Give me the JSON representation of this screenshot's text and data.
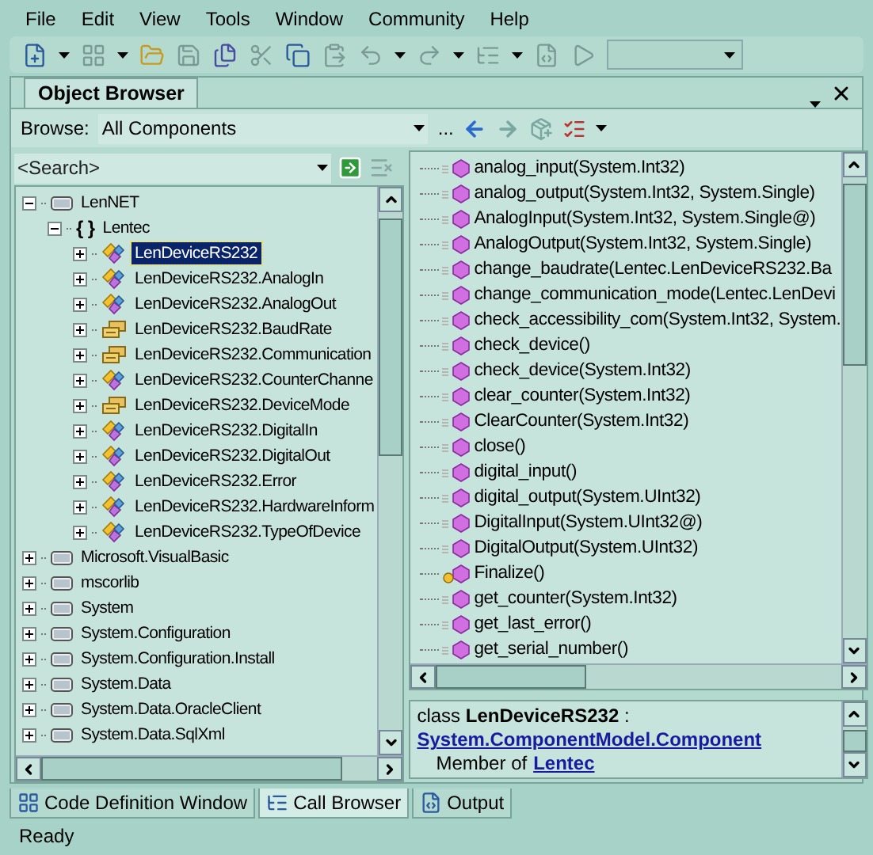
{
  "menu": [
    "File",
    "Edit",
    "View",
    "Tools",
    "Window",
    "Community",
    "Help"
  ],
  "doc_tab": {
    "title": "Object Browser"
  },
  "browse": {
    "label": "Browse:",
    "value": "All Components",
    "more": "..."
  },
  "search": {
    "placeholder": "<Search>"
  },
  "tree": [
    {
      "label": "LenNET",
      "kind": "assembly",
      "expanded": true,
      "selected": false,
      "children": [
        {
          "label": "Lentec",
          "kind": "namespace",
          "icon": "{ }",
          "expanded": true,
          "selected": false,
          "children": [
            {
              "label": "LenDeviceRS232",
              "kind": "class",
              "expanded": false,
              "selected": true
            },
            {
              "label": "LenDeviceRS232.AnalogIn",
              "kind": "class",
              "expanded": false,
              "selected": false
            },
            {
              "label": "LenDeviceRS232.AnalogOut",
              "kind": "class",
              "expanded": false,
              "selected": false
            },
            {
              "label": "LenDeviceRS232.BaudRate",
              "kind": "enum",
              "expanded": false,
              "selected": false
            },
            {
              "label": "LenDeviceRS232.Communication",
              "kind": "enum",
              "expanded": false,
              "selected": false
            },
            {
              "label": "LenDeviceRS232.CounterChanne",
              "kind": "class",
              "expanded": false,
              "selected": false
            },
            {
              "label": "LenDeviceRS232.DeviceMode",
              "kind": "enum",
              "expanded": false,
              "selected": false
            },
            {
              "label": "LenDeviceRS232.DigitalIn",
              "kind": "class",
              "expanded": false,
              "selected": false
            },
            {
              "label": "LenDeviceRS232.DigitalOut",
              "kind": "class",
              "expanded": false,
              "selected": false
            },
            {
              "label": "LenDeviceRS232.Error",
              "kind": "class",
              "expanded": false,
              "selected": false
            },
            {
              "label": "LenDeviceRS232.HardwareInform",
              "kind": "class",
              "expanded": false,
              "selected": false
            },
            {
              "label": "LenDeviceRS232.TypeOfDevice",
              "kind": "class",
              "expanded": false,
              "selected": false
            }
          ]
        }
      ]
    },
    {
      "label": "Microsoft.VisualBasic",
      "kind": "assembly",
      "expanded": false,
      "selected": false
    },
    {
      "label": "mscorlib",
      "kind": "assembly",
      "expanded": false,
      "selected": false
    },
    {
      "label": "System",
      "kind": "assembly",
      "expanded": false,
      "selected": false
    },
    {
      "label": "System.Configuration",
      "kind": "assembly",
      "expanded": false,
      "selected": false
    },
    {
      "label": "System.Configuration.Install",
      "kind": "assembly",
      "expanded": false,
      "selected": false
    },
    {
      "label": "System.Data",
      "kind": "assembly",
      "expanded": false,
      "selected": false
    },
    {
      "label": "System.Data.OracleClient",
      "kind": "assembly",
      "expanded": false,
      "selected": false
    },
    {
      "label": "System.Data.SqlXml",
      "kind": "assembly",
      "expanded": false,
      "selected": false
    }
  ],
  "members": [
    {
      "label": "analog_input(System.Int32)",
      "kind": "public"
    },
    {
      "label": "analog_output(System.Int32, System.Single)",
      "kind": "public"
    },
    {
      "label": "AnalogInput(System.Int32, System.Single@)",
      "kind": "public"
    },
    {
      "label": "AnalogOutput(System.Int32, System.Single)",
      "kind": "public"
    },
    {
      "label": "change_baudrate(Lentec.LenDeviceRS232.Ba",
      "kind": "public"
    },
    {
      "label": "change_communication_mode(Lentec.LenDevi",
      "kind": "public"
    },
    {
      "label": "check_accessibility_com(System.Int32, System.",
      "kind": "public"
    },
    {
      "label": "check_device()",
      "kind": "public"
    },
    {
      "label": "check_device(System.Int32)",
      "kind": "public"
    },
    {
      "label": "clear_counter(System.Int32)",
      "kind": "public"
    },
    {
      "label": "ClearCounter(System.Int32)",
      "kind": "public"
    },
    {
      "label": "close()",
      "kind": "public"
    },
    {
      "label": "digital_input()",
      "kind": "public"
    },
    {
      "label": "digital_output(System.UInt32)",
      "kind": "public"
    },
    {
      "label": "DigitalInput(System.UInt32@)",
      "kind": "public"
    },
    {
      "label": "DigitalOutput(System.UInt32)",
      "kind": "public"
    },
    {
      "label": "Finalize()",
      "kind": "protected"
    },
    {
      "label": "get_counter(System.Int32)",
      "kind": "public"
    },
    {
      "label": "get_last_error()",
      "kind": "public"
    },
    {
      "label": "get_serial_number()",
      "kind": "public"
    }
  ],
  "description": {
    "line1": "class **LenDeviceRS232** :",
    "base_link": "System.ComponentModel.Component",
    "member_of": "Member of",
    "namespace_link": "Lentec"
  },
  "bottom_tabs": [
    {
      "label": "Code Definition Window",
      "selected": false
    },
    {
      "label": "Call Browser",
      "selected": true
    },
    {
      "label": "Output",
      "selected": false
    }
  ],
  "status": "Ready"
}
